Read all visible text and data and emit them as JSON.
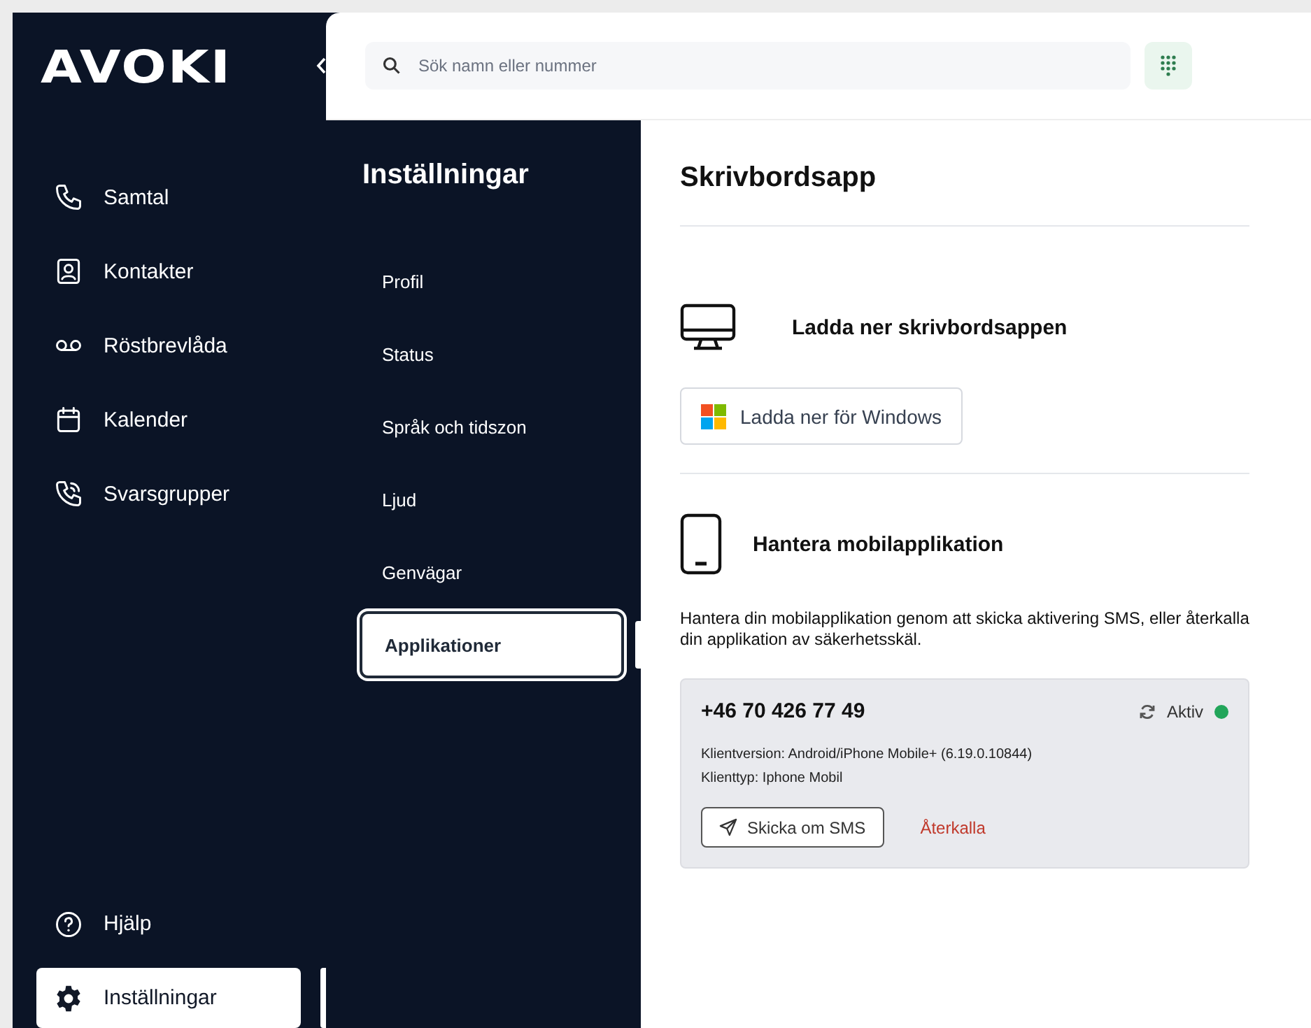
{
  "logo": "AVOKI",
  "search": {
    "placeholder": "Sök namn eller nummer"
  },
  "nav": {
    "items": [
      {
        "label": "Samtal",
        "kind": "phone",
        "selected": false
      },
      {
        "label": "Kontakter",
        "kind": "contact",
        "selected": false
      },
      {
        "label": "Röstbrevlåda",
        "kind": "voicemail",
        "selected": false
      },
      {
        "label": "Kalender",
        "kind": "calendar",
        "selected": false
      },
      {
        "label": "Svarsgrupper",
        "kind": "group",
        "selected": false
      }
    ],
    "bottom_items": [
      {
        "label": "Hjälp",
        "kind": "help",
        "selected": false
      },
      {
        "label": "Inställningar",
        "kind": "settings",
        "selected": true
      }
    ]
  },
  "settings_menu": {
    "title": "Inställningar",
    "items": [
      {
        "label": "Profil",
        "selected": false
      },
      {
        "label": "Status",
        "selected": false
      },
      {
        "label": "Språk och tidszon",
        "selected": false
      },
      {
        "label": "Ljud",
        "selected": false
      },
      {
        "label": "Genvägar",
        "selected": false
      },
      {
        "label": "Applikationer",
        "selected": true
      }
    ]
  },
  "content": {
    "title": "Skrivbordsapp",
    "desktop": {
      "heading": "Ladda ner skrivbordsappen",
      "button": "Ladda ner för Windows"
    },
    "mobile": {
      "heading": "Hantera mobilapplikation",
      "description": "Hantera din mobilapplikation genom att skicka aktivering SMS, eller återkalla din applikation av säkerhetsskäl.",
      "device": {
        "number": "+46 70 426 77 49",
        "status": "Aktiv",
        "active": true,
        "client_version": "Klientversion: Android/iPhone Mobile+ (6.19.0.10844)",
        "client_type": "Klienttyp: Iphone Mobil",
        "resend": "Skicka om SMS",
        "revoke": "Återkalla"
      }
    }
  }
}
